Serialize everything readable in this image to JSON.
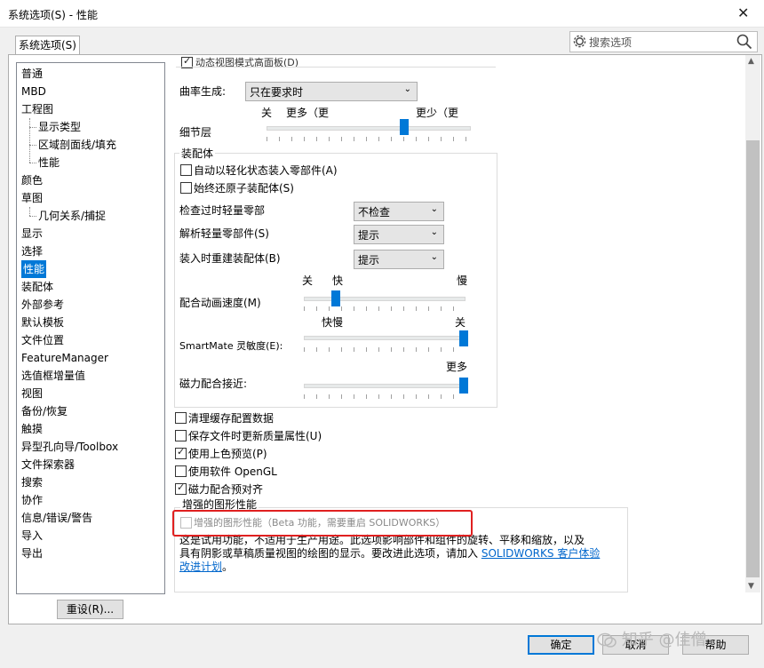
{
  "window": {
    "title": "系统选项(S) - 性能",
    "close_glyph": "✕"
  },
  "tab": {
    "label": "系统选项(S)"
  },
  "search": {
    "placeholder": "搜索选项"
  },
  "tree": [
    {
      "label": "普通",
      "level": 0
    },
    {
      "label": "MBD",
      "level": 0
    },
    {
      "label": "工程图",
      "level": 0
    },
    {
      "label": "显示类型",
      "level": 1
    },
    {
      "label": "区域剖面线/填充",
      "level": 1
    },
    {
      "label": "性能",
      "level": 1
    },
    {
      "label": "颜色",
      "level": 0
    },
    {
      "label": "草图",
      "level": 0
    },
    {
      "label": "几何关系/捕捉",
      "level": 1
    },
    {
      "label": "显示",
      "level": 0
    },
    {
      "label": "选择",
      "level": 0
    },
    {
      "label": "性能",
      "level": 0,
      "selected": true
    },
    {
      "label": "装配体",
      "level": 0
    },
    {
      "label": "外部参考",
      "level": 0
    },
    {
      "label": "默认模板",
      "level": 0
    },
    {
      "label": "文件位置",
      "level": 0
    },
    {
      "label": "FeatureManager",
      "level": 0
    },
    {
      "label": "选值框增量值",
      "level": 0
    },
    {
      "label": "视图",
      "level": 0
    },
    {
      "label": "备份/恢复",
      "level": 0
    },
    {
      "label": "触摸",
      "level": 0
    },
    {
      "label": "异型孔向导/Toolbox",
      "level": 0
    },
    {
      "label": "文件探索器",
      "level": 0
    },
    {
      "label": "搜索",
      "level": 0
    },
    {
      "label": "协作",
      "level": 0
    },
    {
      "label": "信息/错误/警告",
      "level": 0
    },
    {
      "label": "导入",
      "level": 0
    },
    {
      "label": "导出",
      "level": 0
    }
  ],
  "top_partial": {
    "label": "动态视图模式高面板(D)",
    "checked": true
  },
  "curvature": {
    "label": "曲率生成:",
    "value": "只在要求时"
  },
  "detail": {
    "label": "细节层",
    "left_label": "关",
    "left_label2": "更多（更",
    "right_label": "更少（更",
    "level": 0.68
  },
  "assembly": {
    "title": "装配体",
    "auto_lightweight": {
      "label": "自动以轻化状态装入零部件(A)",
      "checked": false
    },
    "always_resolve": {
      "label": "始终还原子装配体(S)",
      "checked": false
    },
    "check_outdated": {
      "label": "检查过时轻量零部",
      "value": "不检查"
    },
    "resolve_lightweight": {
      "label": "解析轻量零部件(S)",
      "value": "提示"
    },
    "rebuild_on_load": {
      "label": "装入时重建装配体(B)",
      "value": "提示"
    },
    "mate_anim": {
      "label": "配合动画速度(M)",
      "left_label": "关",
      "left_label2": "快",
      "right_label": "慢",
      "level": 0.2
    },
    "smartmate": {
      "label": "SmartMate 灵敏度(E):",
      "left_label": "快慢",
      "right_label": "关",
      "level": 1.0
    },
    "magnetic": {
      "label": "磁力配合接近:",
      "right_label": "更多",
      "level": 1.0
    }
  },
  "options": [
    {
      "label": "清理缓存配置数据",
      "checked": false
    },
    {
      "label": "保存文件时更新质量属性(U)",
      "checked": false
    },
    {
      "label": "使用上色预览(P)",
      "checked": true
    },
    {
      "label": "使用软件 OpenGL",
      "checked": false
    },
    {
      "label": "磁力配合预对齐",
      "checked": true
    }
  ],
  "enhanced": {
    "title": "增强的图形性能",
    "checkbox_label": "增强的图形性能（Beta 功能，需要重启 SOLIDWORKS）",
    "desc_line1": "这是试用功能，不适用于生产用途。此选项影响部件和组件的旋转、平移和缩放，以及",
    "desc_line2": "具有阴影或草稿质量视图的绘图的显示。要改进此选项，请加入",
    "desc_link1": "SOLIDWORKS 客户体验",
    "desc_link2": "改进计划",
    "desc_end": "。"
  },
  "buttons": {
    "reset": "重设(R)...",
    "ok": "确定",
    "cancel": "取消",
    "help": "帮助"
  },
  "watermark": "知乎 @佳僧",
  "colors": {
    "accent": "#0078d7",
    "highlight_border": "#e02020",
    "link": "#0066cc"
  }
}
